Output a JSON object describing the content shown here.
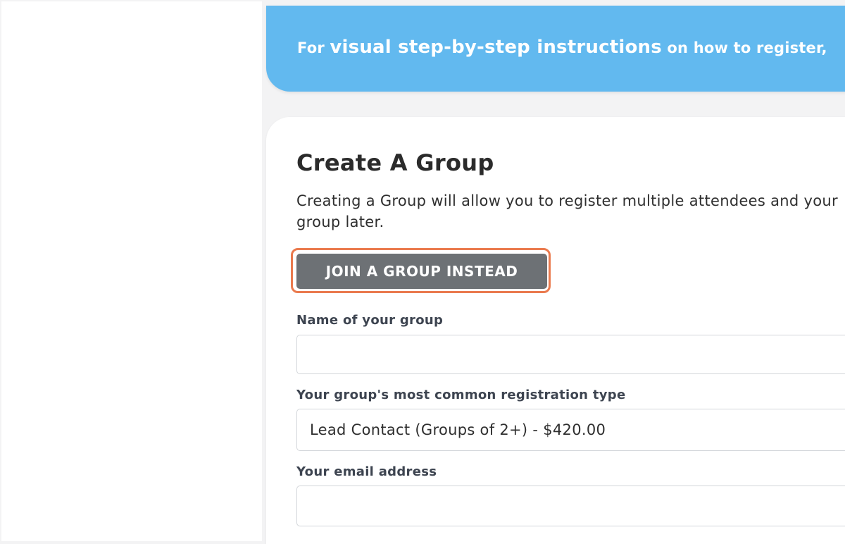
{
  "banner": {
    "prefix": "For ",
    "emphasis": "visual step-by-step instructions",
    "suffix": " on how to register,"
  },
  "form": {
    "title": "Create A Group",
    "description": "Creating a Group will allow you to register multiple attendees and your group later.",
    "join_button_label": "JOIN A GROUP INSTEAD",
    "group_name_label": "Name of your group",
    "group_name_value": "",
    "registration_type_label": "Your group's most common registration type",
    "registration_type_selected": "Lead Contact (Groups of 2+) - $420.00",
    "email_label": "Your email address",
    "email_value": ""
  },
  "colors": {
    "banner": "#62b9ef",
    "button": "#6d7175",
    "highlight": "#ea7a4e"
  }
}
